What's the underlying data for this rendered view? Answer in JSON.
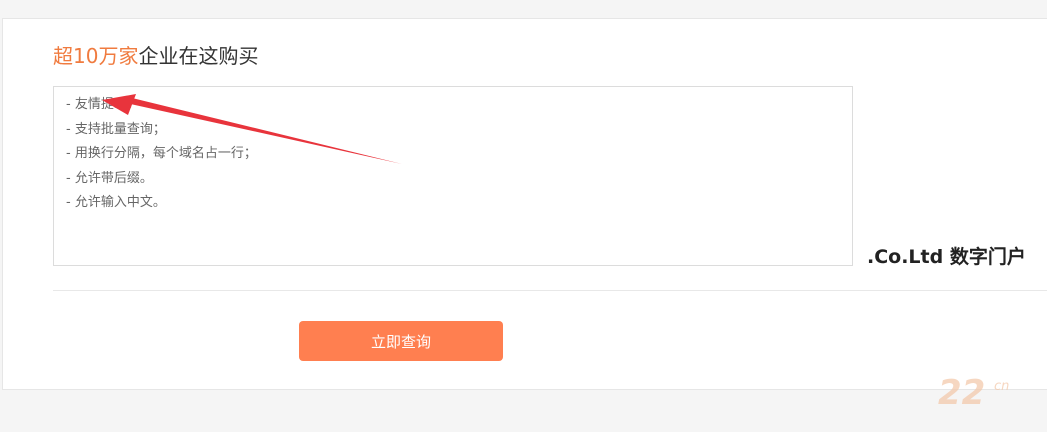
{
  "heading": {
    "accent": "超10万家",
    "rest": "企业在这购买"
  },
  "domain_input": {
    "hint_lines": [
      "- 友情提示：",
      "- 支持批量查询；",
      "- 用换行分隔，每个域名占一行；",
      "- 允许带后缀。",
      "- 允许输入中文。"
    ]
  },
  "side_label": ".Co.Ltd 数字门户",
  "submit_button": {
    "label": "立即查询"
  },
  "colors": {
    "accent": "#f07b3f",
    "button": "#ff7f50",
    "arrow": "#e8343c"
  },
  "icons": {
    "annotation": "red-arrow-icon",
    "watermark": "22cn-watermark-icon"
  }
}
